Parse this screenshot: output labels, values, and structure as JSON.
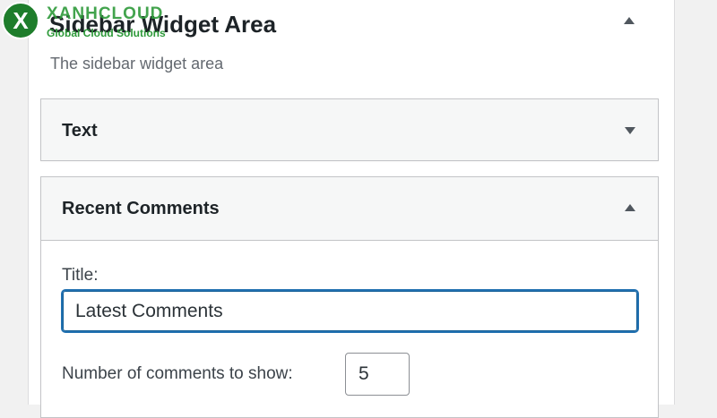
{
  "widget_area": {
    "title": "Sidebar Widget Area",
    "description": "The sidebar widget area"
  },
  "widgets": {
    "text": {
      "title": "Text"
    },
    "recent_comments": {
      "title": "Recent Comments",
      "title_label": "Title:",
      "title_value": "Latest Comments",
      "number_label": "Number of comments to show:",
      "number_value": "5"
    }
  },
  "watermark": {
    "mark": "X",
    "name": "XANHCLOUD",
    "tagline": "Global Cloud Solutions"
  },
  "colors": {
    "focus_border": "#2271b1",
    "watermark_green": "#2e9a3a"
  }
}
